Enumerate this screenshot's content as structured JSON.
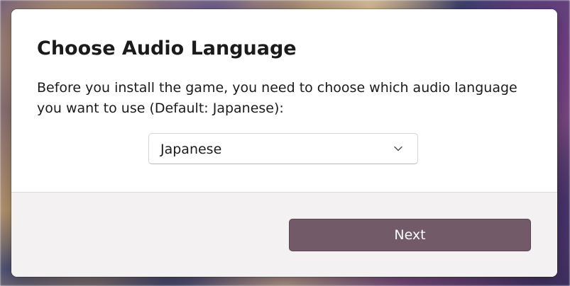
{
  "dialog": {
    "title": "Choose Audio Language",
    "description": "Before you install the game, you need to choose which audio language you want to use (Default: Japanese):",
    "language_select": {
      "selected": "Japanese"
    },
    "next_label": "Next"
  },
  "colors": {
    "primary_button": "#725a69",
    "footer_background": "#f3f1f2"
  },
  "icons": {
    "dropdown": "chevron-down-icon"
  }
}
